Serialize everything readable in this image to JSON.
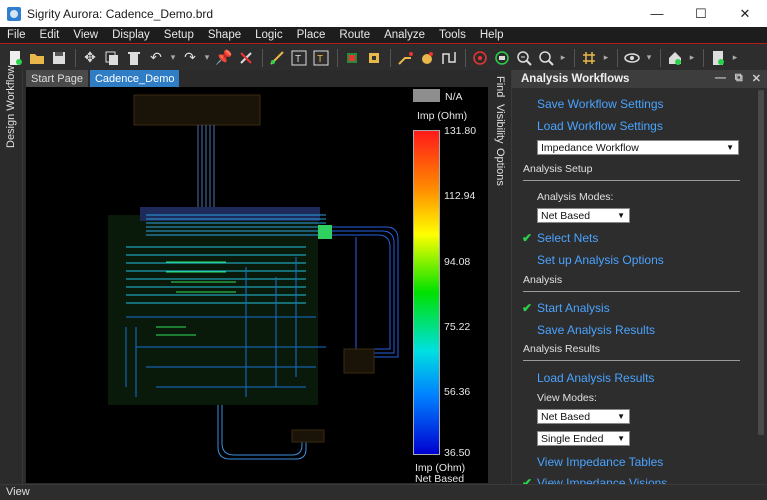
{
  "window": {
    "title": "Sigrity Aurora: Cadence_Demo.brd",
    "minimize": "—",
    "maximize": "☐",
    "close": "✕"
  },
  "menu": [
    "File",
    "Edit",
    "View",
    "Display",
    "Setup",
    "Shape",
    "Logic",
    "Place",
    "Route",
    "Analyze",
    "Tools",
    "Help"
  ],
  "toolbar_icons": [
    "new-icon",
    "open-icon",
    "save-icon",
    "move-icon",
    "copy-icon",
    "delete-icon",
    "undo-icon",
    "redo-icon",
    "pin-icon",
    "unpin-icon",
    "add-connect-icon",
    "text-icon",
    "text-edit-icon",
    "component-icon",
    "chip-icon",
    "route-icon",
    "hand-icon",
    "slide-icon",
    "drc-icon",
    "zoom-fit-icon",
    "zoom-in-icon",
    "zoom-out-icon",
    "grid-icon",
    "eye-icon",
    "home-icon",
    "report-icon"
  ],
  "left_tab": "Design Workflow",
  "doc_tabs": [
    "Start Page",
    "Cadence_Demo"
  ],
  "active_doc_tab": "Cadence_Demo",
  "legend": {
    "na_label": "N/A",
    "title": "Imp (Ohm)",
    "ticks": [
      "131.80",
      "112.94",
      "94.08",
      "75.22",
      "56.36",
      "36.50"
    ],
    "footer_unit": "Imp (Ohm)",
    "footer_mode": "Net Based",
    "colors": {
      "high": "#ff1a1a",
      "mid": "#00e000",
      "low": "#0000d0",
      "na": "#8e8e8e"
    }
  },
  "mid_tabs": [
    "Find",
    "Visibility",
    "Options"
  ],
  "panel": {
    "title": "Analysis Workflows",
    "save_settings": "Save Workflow Settings",
    "load_settings": "Load Workflow Settings",
    "workflow_select": "Impedance Workflow",
    "section_setup": "Analysis Setup",
    "analysis_modes_label": "Analysis Modes:",
    "analysis_modes_value": "Net Based",
    "select_nets": "Select Nets",
    "setup_options": "Set up Analysis Options",
    "section_analysis": "Analysis",
    "start_analysis": "Start Analysis",
    "save_results": "Save Analysis Results",
    "section_results": "Analysis Results",
    "load_results": "Load Analysis Results",
    "view_modes_label": "View Modes:",
    "view_mode_1": "Net Based",
    "view_mode_2": "Single Ended",
    "view_tables": "View Impedance Tables",
    "view_visions": "View Impedance Visions",
    "link_color": "#4aa3ff",
    "check_color": "#2bd24b"
  },
  "status": "View"
}
